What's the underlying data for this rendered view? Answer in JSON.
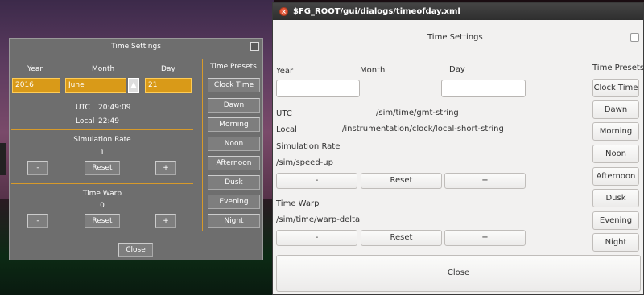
{
  "fg_dialog": {
    "title": "Time Settings",
    "year_label": "Year",
    "month_label": "Month",
    "day_label": "Day",
    "year_value": "2016",
    "month_value": "June",
    "day_value": "21",
    "utc_label": "UTC",
    "utc_value": "20:49:09",
    "local_label": "Local",
    "local_value": "22:49",
    "sim_rate_label": "Simulation Rate",
    "sim_rate_value": "1",
    "time_warp_label": "Time Warp",
    "time_warp_value": "0",
    "minus": "-",
    "plus": "+",
    "reset": "Reset",
    "close": "Close",
    "presets_title": "Time Presets",
    "presets": [
      "Clock Time",
      "Dawn",
      "Morning",
      "Noon",
      "Afternoon",
      "Dusk",
      "Evening",
      "Night"
    ],
    "colors": {
      "field": "#d99a18",
      "divider": "#d79a2a",
      "background": "#6e6e6e"
    }
  },
  "xml_window": {
    "title": "$FG_ROOT/gui/dialogs/timeofday.xml",
    "heading": "Time Settings",
    "year_label": "Year",
    "month_label": "Month",
    "day_label": "Day",
    "presets_title": "Time Presets",
    "utc_label": "UTC",
    "utc_prop": "/sim/time/gmt-string",
    "local_label": "Local",
    "local_prop": "/instrumentation/clock/local-short-string",
    "sim_rate_label": "Simulation Rate",
    "sim_rate_prop": "/sim/speed-up",
    "time_warp_label": "Time Warp",
    "time_warp_prop": "/sim/time/warp-delta",
    "minus": "-",
    "plus": "+",
    "reset": "Reset",
    "close": "Close",
    "presets": [
      "Clock Time",
      "Dawn",
      "Morning",
      "Noon",
      "Afternoon",
      "Dusk",
      "Evening",
      "Night"
    ]
  }
}
